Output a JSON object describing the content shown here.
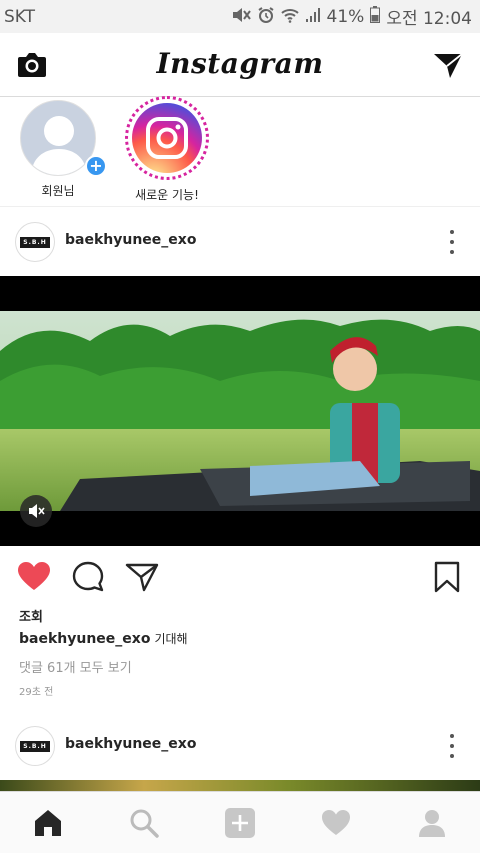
{
  "status_bar": {
    "carrier": "SKT",
    "battery": "41%",
    "time": "오전 12:04",
    "icons": [
      "mute-icon",
      "alarm-icon",
      "wifi-icon",
      "signal-icon",
      "battery-icon"
    ]
  },
  "header": {
    "title": "Instagram",
    "left_icon": "camera-icon",
    "right_icon": "direct-message-icon"
  },
  "stories": [
    {
      "label": "회원님",
      "icon": "add-story-icon"
    },
    {
      "label": "새로운 기능!",
      "icon": "instagram-logo-icon"
    }
  ],
  "post1": {
    "username": "baekhyunee_exo",
    "avatar_text": "S.B.H",
    "views_label": "조회",
    "caption_user": "baekhyunee_exo",
    "caption_text": "기대해",
    "comments_link": "댓글 61개 모두 보기",
    "time_ago": "29초 전"
  },
  "post2": {
    "username": "baekhyunee_exo",
    "avatar_text": "S.B.H"
  },
  "colors": {
    "like_red": "#ed4956",
    "link_blue": "#3897f0",
    "border": "#dbdbdb"
  },
  "bottom_nav": [
    "home-icon",
    "search-icon",
    "add-post-icon",
    "activity-heart-icon",
    "profile-icon"
  ]
}
